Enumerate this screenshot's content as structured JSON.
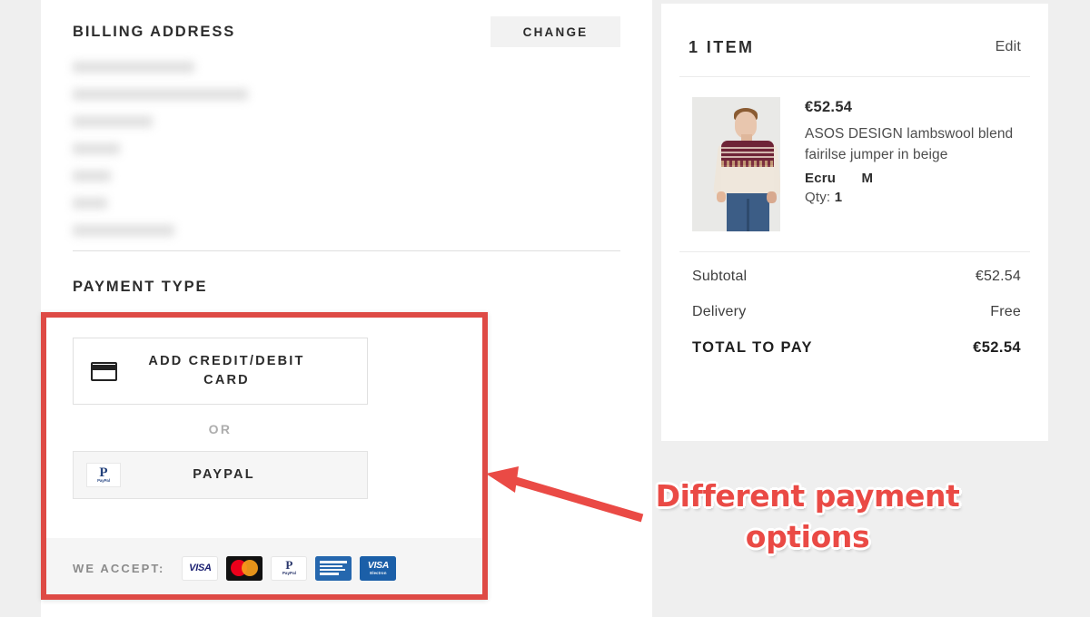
{
  "billing": {
    "title": "BILLING ADDRESS",
    "change_label": "CHANGE",
    "address_lines_redacted": 7
  },
  "payment": {
    "title": "PAYMENT TYPE",
    "card_button_label": "ADD CREDIT/DEBIT CARD",
    "or_label": "OR",
    "paypal_button_label": "PAYPAL",
    "we_accept_label": "WE ACCEPT:",
    "accepted_cards": [
      {
        "name": "visa",
        "text": "VISA"
      },
      {
        "name": "mastercard",
        "text": ""
      },
      {
        "name": "paypal",
        "text": "P",
        "sub": "PayPal"
      },
      {
        "name": "american-express",
        "text": ""
      },
      {
        "name": "visa-electron",
        "text": "VISA",
        "sub": "Electron"
      }
    ],
    "paypal_glyph": {
      "mark": "P",
      "word": "PayPal"
    }
  },
  "summary": {
    "items_count_label": "1 ITEM",
    "edit_label": "Edit",
    "item": {
      "price": "€52.54",
      "name": "ASOS DESIGN lambswool blend fairilse jumper in beige",
      "colour": "Ecru",
      "size": "M",
      "qty_label": "Qty:",
      "qty_value": "1"
    },
    "totals": [
      {
        "label": "Subtotal",
        "value": "€52.54"
      },
      {
        "label": "Delivery",
        "value": "Free"
      }
    ],
    "grand_total": {
      "label": "TOTAL TO PAY",
      "value": "€52.54"
    }
  },
  "annotation": {
    "text": "Different payment options",
    "color": "#ea4a45",
    "highlight_box_color": "#de4a45"
  }
}
